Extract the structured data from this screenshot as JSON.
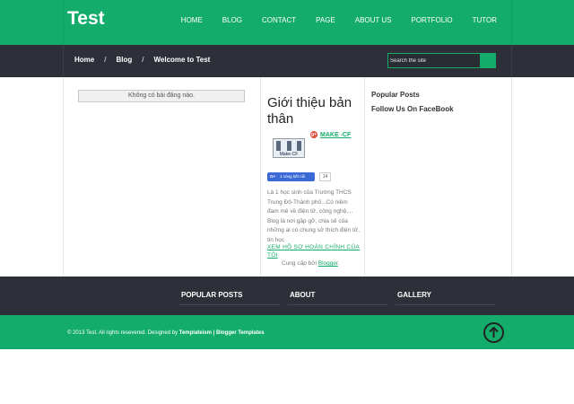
{
  "header": {
    "site_title": "Test",
    "nav": [
      "HOME",
      "BLOG",
      "CONTACT",
      "PAGE",
      "ABOUT US",
      "PORTFOLIO",
      "TUTOR"
    ]
  },
  "breadcrumb": {
    "items": [
      "Home",
      "Blog",
      "Welcome to Test"
    ],
    "separator": "/"
  },
  "search": {
    "placeholder": "Search the site"
  },
  "main": {
    "no_posts": "Không có bài đăng nào."
  },
  "profile": {
    "title": "Giới thiệu bản thân",
    "name": "MAKE -CF",
    "avatar_caption": "Make-CF",
    "gplus_label": "g+",
    "follow_label": "1 vòng kết nối",
    "follow_g": "G+",
    "follow_count": "14",
    "bio": "Là 1 học sinh của Trường THCS Trung Độ-Thành phố...Có niềm đam mê về điện tử, công nghệ,... Blog là nơi gặp gỡ, chia sẻ của những ai có chung sở thích điện tử, tin học",
    "full_profile": "XEM HỒ SƠ HOÀN CHỈNH CỦA TÔI",
    "powered_prefix": "Cung cấp bởi",
    "powered_link": "Blogger",
    "powered_suffix": "."
  },
  "sidebar": {
    "popular_posts": "Popular Posts",
    "follow_fb": "Follow Us On FaceBook"
  },
  "footer": {
    "widgets": [
      "POPULAR POSTS",
      "ABOUT",
      "GALLERY"
    ],
    "copyright": "© 2013 Test. All rights resevered. Designed by",
    "designer": "Templateism",
    "sep": "|",
    "templates": "Blogger Templates"
  },
  "colors": {
    "brand_green": "#13ac6b",
    "dark_bar": "#2e3039"
  },
  "icons": {
    "back_to_top": "arrow-up-circle-icon"
  }
}
